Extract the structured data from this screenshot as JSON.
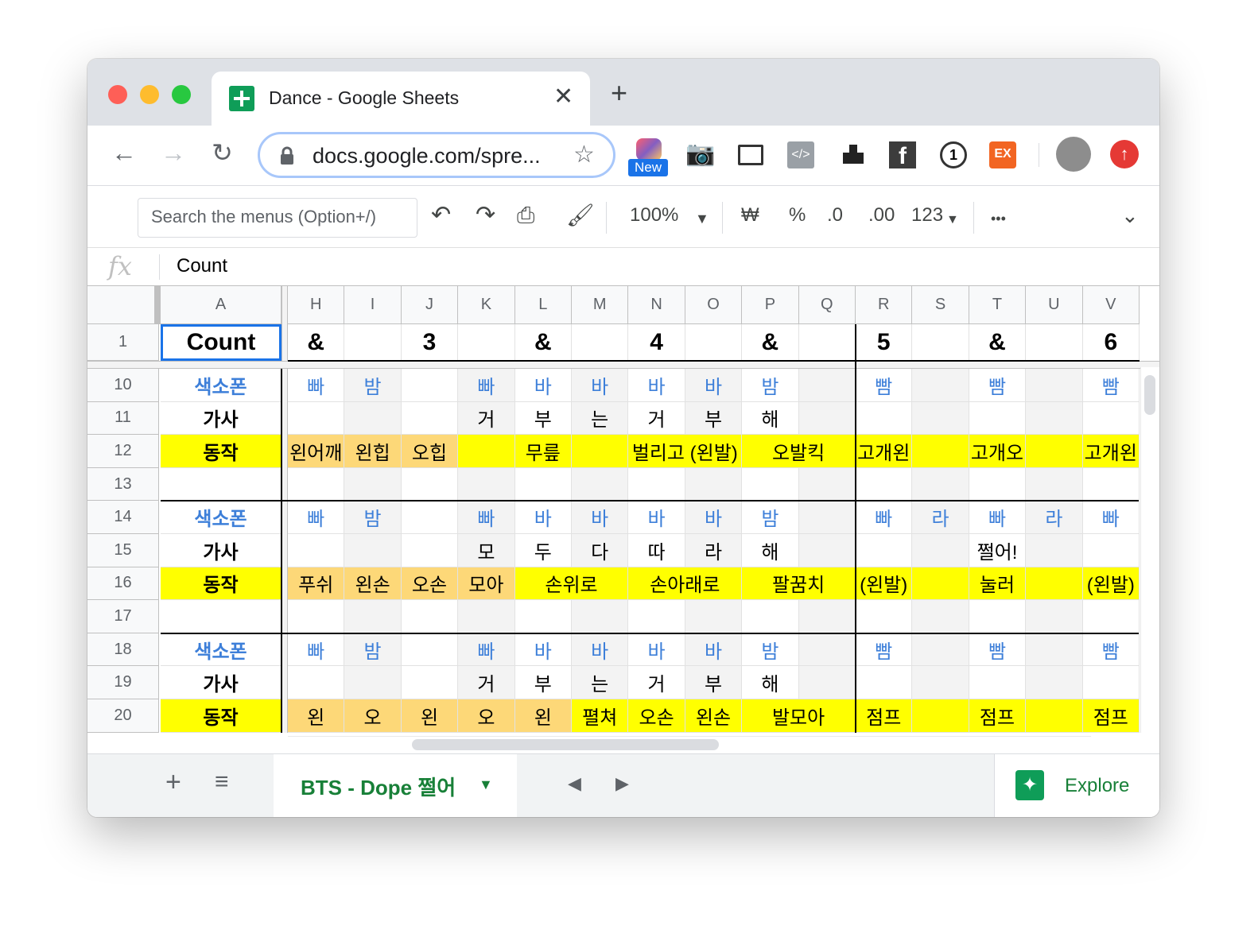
{
  "tab": {
    "title": "Dance - Google Sheets"
  },
  "address": {
    "url": "docs.google.com/spre..."
  },
  "extensions": {
    "new_badge": "New",
    "ex_label": "EX"
  },
  "toolbar": {
    "search_placeholder": "Search the menus (Option+/)",
    "zoom": "100%",
    "currency": "₩",
    "percent": "%",
    "dec_decrease": ".0",
    "dec_increase": ".00",
    "format_more": "123",
    "more": "•••"
  },
  "formula_bar": {
    "fx": "fx",
    "value": "Count"
  },
  "columns": [
    "A",
    "H",
    "I",
    "J",
    "K",
    "L",
    "M",
    "N",
    "O",
    "P",
    "Q",
    "R",
    "S",
    "T",
    "U",
    "V"
  ],
  "rows": [
    {
      "num": "1",
      "label": "Count",
      "cells": [
        "&",
        "",
        "3",
        "",
        "&",
        "",
        "4",
        "",
        "&",
        "",
        "5",
        "",
        "&",
        "",
        "6"
      ]
    },
    {
      "num": "10",
      "label": "색소폰",
      "cells": [
        "빠",
        "밤",
        "",
        "빠",
        "바",
        "바",
        "바",
        "바",
        "밤",
        "",
        "빰",
        "",
        "빰",
        "",
        "빰"
      ]
    },
    {
      "num": "11",
      "label": "가사",
      "cells": [
        "",
        "",
        "",
        "거",
        "부",
        "는",
        "거",
        "부",
        "해",
        "",
        "",
        "",
        "",
        "",
        ""
      ]
    },
    {
      "num": "12",
      "label": "동작",
      "cells": [
        "왼어깨",
        "왼힙",
        "오힙",
        "",
        "무릎",
        "",
        "벌리고 (왼발)",
        "",
        "오발킥",
        "",
        "고개왼",
        "",
        "고개오",
        "",
        "고개왼"
      ]
    },
    {
      "num": "13",
      "label": "",
      "cells": [
        "",
        "",
        "",
        "",
        "",
        "",
        "",
        "",
        "",
        "",
        "",
        "",
        "",
        "",
        ""
      ]
    },
    {
      "num": "14",
      "label": "색소폰",
      "cells": [
        "빠",
        "밤",
        "",
        "빠",
        "바",
        "바",
        "바",
        "바",
        "밤",
        "",
        "빠",
        "라",
        "빠",
        "라",
        "빠"
      ]
    },
    {
      "num": "15",
      "label": "가사",
      "cells": [
        "",
        "",
        "",
        "모",
        "두",
        "다",
        "따",
        "라",
        "해",
        "",
        "",
        "",
        "쩔어!",
        "",
        ""
      ]
    },
    {
      "num": "16",
      "label": "동작",
      "cells": [
        "푸쉬",
        "왼손",
        "오손",
        "모아",
        "손위로",
        "",
        "손아래로",
        "",
        "팔꿈치",
        "",
        "(왼발)",
        "",
        "눌러",
        "",
        "(왼발)"
      ]
    },
    {
      "num": "17",
      "label": "",
      "cells": [
        "",
        "",
        "",
        "",
        "",
        "",
        "",
        "",
        "",
        "",
        "",
        "",
        "",
        "",
        ""
      ]
    },
    {
      "num": "18",
      "label": "색소폰",
      "cells": [
        "빠",
        "밤",
        "",
        "빠",
        "바",
        "바",
        "바",
        "바",
        "밤",
        "",
        "빰",
        "",
        "빰",
        "",
        "빰"
      ]
    },
    {
      "num": "19",
      "label": "가사",
      "cells": [
        "",
        "",
        "",
        "거",
        "부",
        "는",
        "거",
        "부",
        "해",
        "",
        "",
        "",
        "",
        "",
        ""
      ]
    },
    {
      "num": "20",
      "label": "동작",
      "cells": [
        "왼",
        "오",
        "왼",
        "오",
        "왼",
        "펼쳐",
        "오손",
        "왼손",
        "발모아",
        "",
        "점프",
        "",
        "점프",
        "",
        "점프"
      ]
    }
  ],
  "sheet": {
    "name": "BTS - Dope 쩔어"
  },
  "explore": {
    "label": "Explore"
  }
}
